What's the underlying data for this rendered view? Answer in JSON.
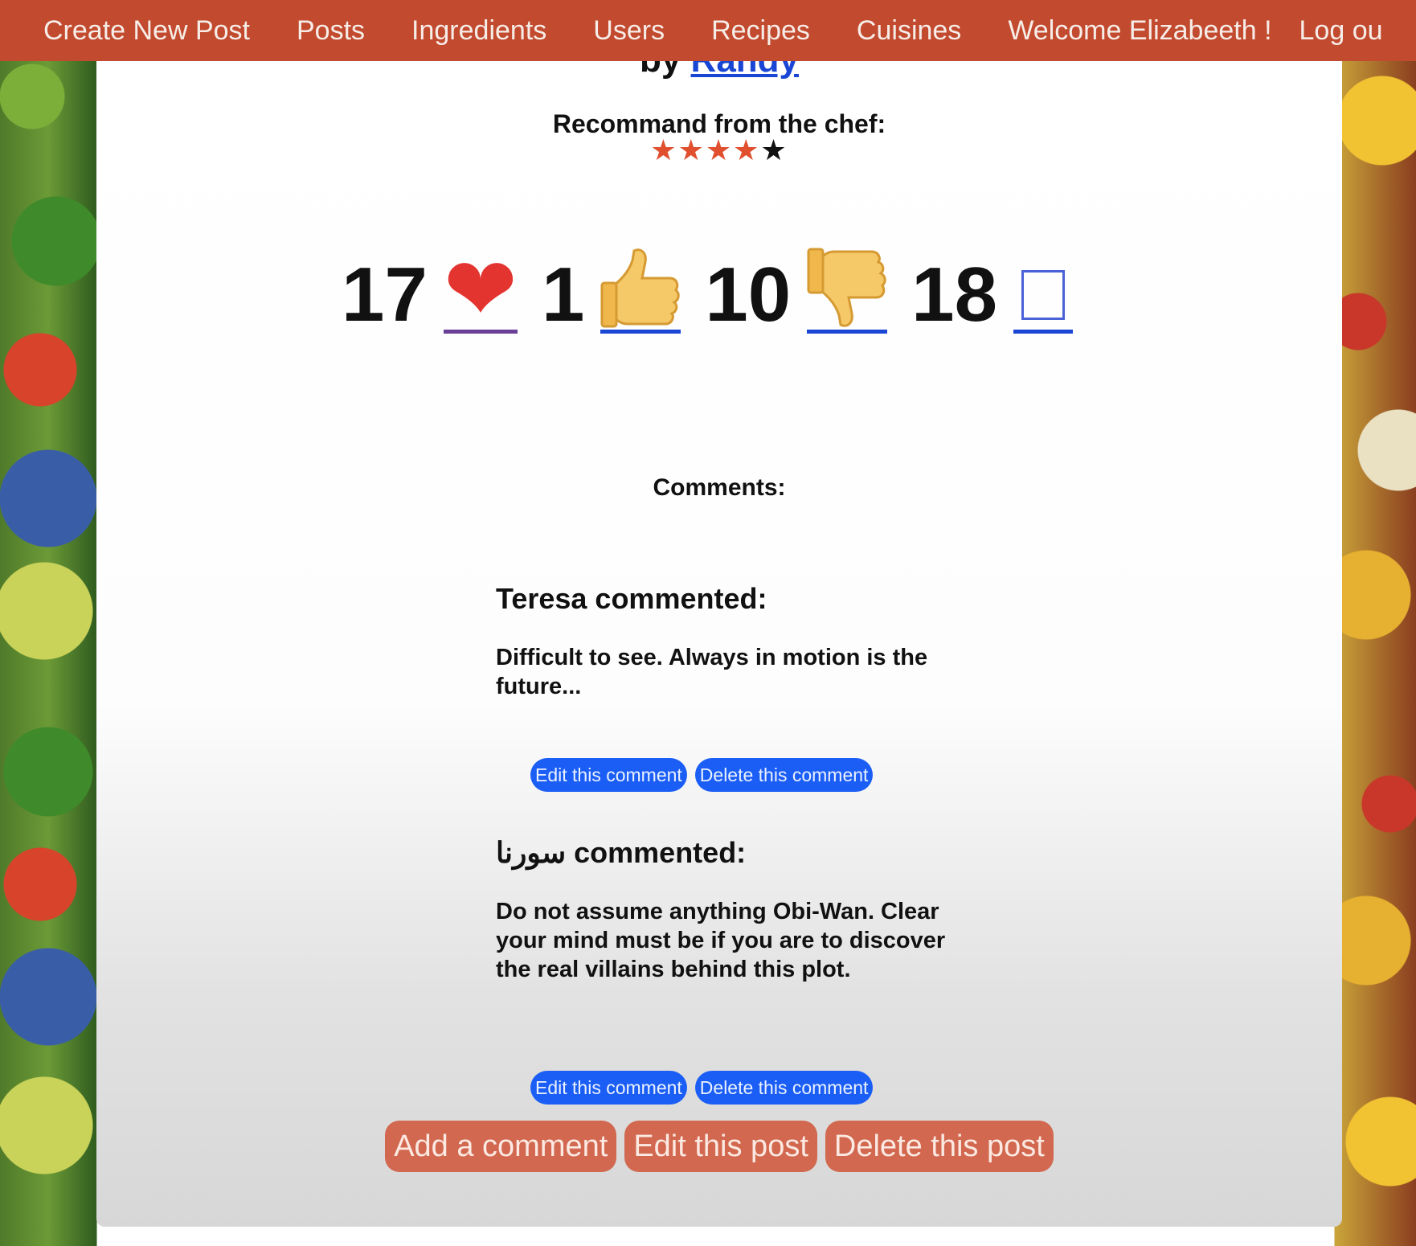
{
  "nav": {
    "items": [
      "Create New Post",
      "Posts",
      "Ingredients",
      "Users",
      "Recipes",
      "Cuisines"
    ],
    "welcome": "Welcome Elizabeeth !",
    "logout": "Log ou"
  },
  "post": {
    "by_prefix": "by",
    "author": "Randy",
    "recommend_label": "Recommand from the chef:",
    "rating": 4,
    "rating_max": 5,
    "star_glyph": "★",
    "accent_color": "#e0502f"
  },
  "reactions": [
    {
      "count": "17",
      "icon": "heart-icon",
      "glyph": "❤"
    },
    {
      "count": "1",
      "icon": "thumbs-up-icon"
    },
    {
      "count": "10",
      "icon": "thumbs-down-icon"
    },
    {
      "count": "18",
      "icon": "missing-glyph-icon"
    }
  ],
  "comments_title": "Comments:",
  "comments": [
    {
      "author_line": "Teresa commented:",
      "body": "Difficult to see. Always in motion is the future...",
      "edit_label": "Edit this comment",
      "delete_label": "Delete this comment"
    },
    {
      "author_line": "سورنا commented:",
      "body": "Do not assume anything Obi-Wan. Clear your mind must be if you are to discover the real villains behind this plot.",
      "edit_label": "Edit this comment",
      "delete_label": "Delete this comment"
    }
  ],
  "actions": {
    "add_comment": "Add a comment",
    "edit_post": "Edit this post",
    "delete_post": "Delete this post"
  }
}
